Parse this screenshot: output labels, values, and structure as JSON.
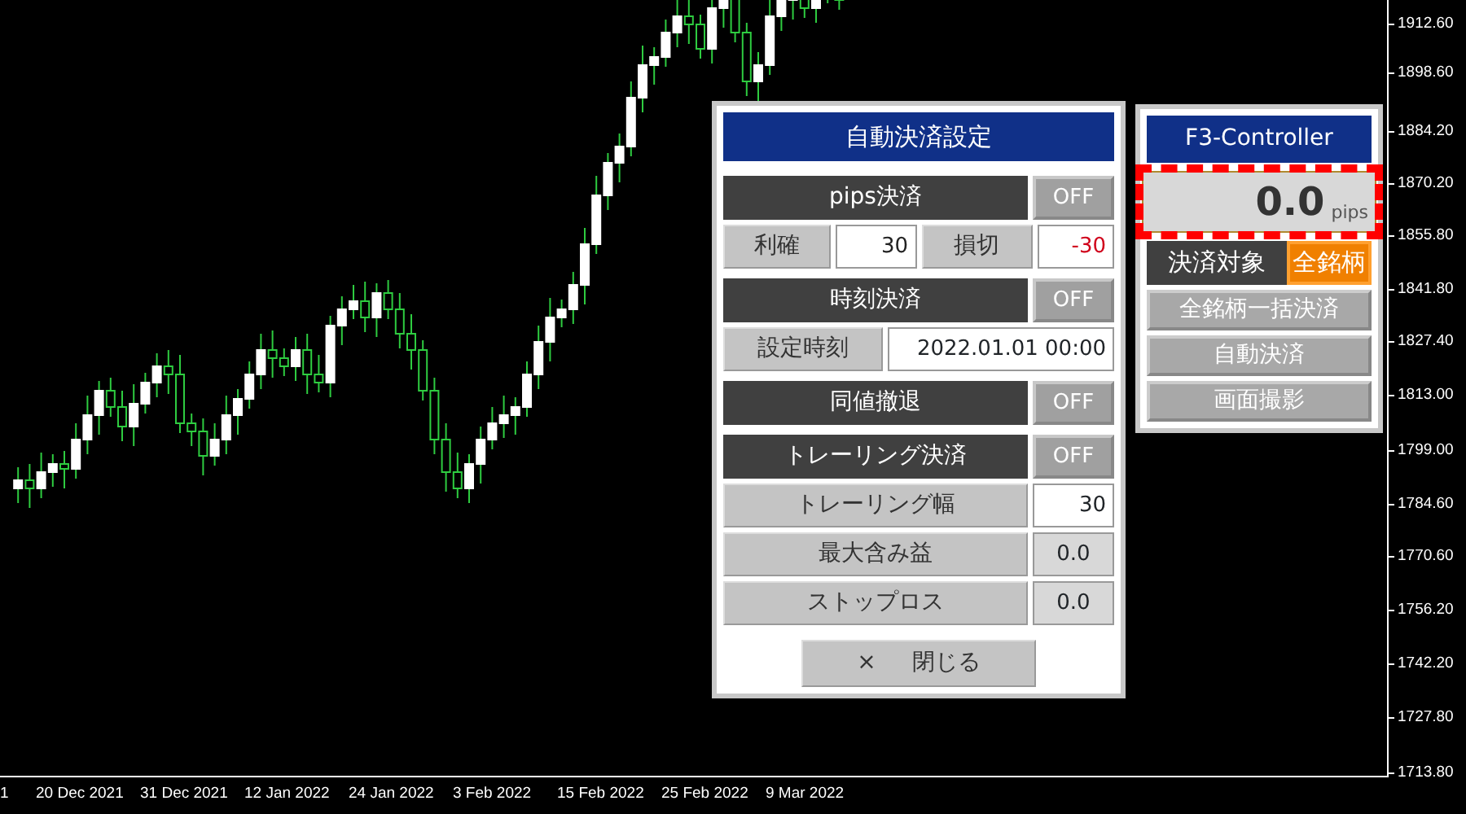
{
  "chart": {
    "price_axis": [
      "1912.60",
      "1898.60",
      "1884.20",
      "1870.20",
      "1855.80",
      "1841.80",
      "1827.40",
      "1813.00",
      "1799.00",
      "1784.60",
      "1770.60",
      "1756.20",
      "1742.20",
      "1727.80",
      "1713.80"
    ],
    "date_axis": [
      "1",
      "20 Dec 2021",
      "31 Dec 2021",
      "12 Jan 2022",
      "24 Jan 2022",
      "3 Feb 2022",
      "15 Feb 2022",
      "25 Feb 2022",
      "9 Mar 2022"
    ]
  },
  "settings_panel": {
    "title": "自動決済設定",
    "sections": [
      {
        "kind": "toggle",
        "label": "pips決済",
        "toggle": "OFF",
        "on": false
      },
      {
        "kind": "pair",
        "items": [
          {
            "label": "利確",
            "value": "30",
            "color": "#222222"
          },
          {
            "label": "損切",
            "value": "-30",
            "color": "#d0021b"
          }
        ]
      },
      {
        "kind": "toggle",
        "label": "時刻決済",
        "toggle": "OFF",
        "on": false
      },
      {
        "kind": "datetime",
        "label": "設定時刻",
        "value": "2022.01.01 00:00"
      },
      {
        "kind": "toggle",
        "label": "同値撤退",
        "toggle": "OFF",
        "on": false
      },
      {
        "kind": "toggle",
        "label": "トレーリング決済",
        "toggle": "OFF",
        "on": false
      },
      {
        "kind": "field",
        "label": "トレーリング幅",
        "value": "30",
        "editable": true
      },
      {
        "kind": "field",
        "label": "最大含み益",
        "value": "0.0",
        "editable": false
      },
      {
        "kind": "field",
        "label": "ストップロス",
        "value": "0.0",
        "editable": false
      }
    ],
    "close_button": {
      "icon": "×",
      "label": "閉じる"
    }
  },
  "controller": {
    "title": "F3-Controller",
    "display": {
      "value": "0.0",
      "unit": "pips",
      "highlighted": true
    },
    "target": {
      "label": "決済対象",
      "value": "全銘柄"
    },
    "buttons": [
      "全銘柄一括決済",
      "自動決済",
      "画面撮影"
    ]
  }
}
